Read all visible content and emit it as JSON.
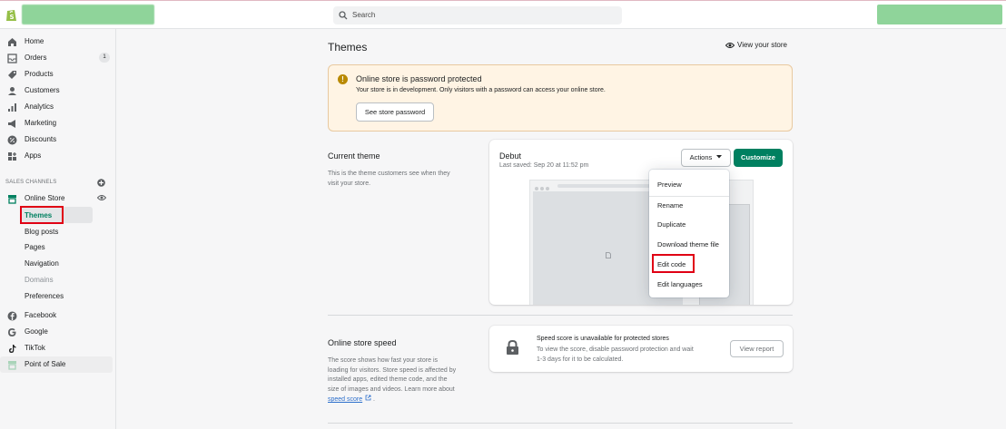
{
  "topbar": {
    "search_placeholder": "Search"
  },
  "sidebar": {
    "items": [
      {
        "label": "Home",
        "icon": "home-icon"
      },
      {
        "label": "Orders",
        "icon": "orders-icon",
        "badge": "1"
      },
      {
        "label": "Products",
        "icon": "tag-icon"
      },
      {
        "label": "Customers",
        "icon": "person-icon"
      },
      {
        "label": "Analytics",
        "icon": "bar-chart-icon"
      },
      {
        "label": "Marketing",
        "icon": "megaphone-icon"
      },
      {
        "label": "Discounts",
        "icon": "discount-icon"
      },
      {
        "label": "Apps",
        "icon": "apps-icon"
      }
    ],
    "sales_channels_label": "SALES CHANNELS",
    "online_store": {
      "label": "Online Store",
      "sub_items": [
        "Themes",
        "Blog posts",
        "Pages",
        "Navigation",
        "Domains",
        "Preferences"
      ]
    },
    "channels": [
      {
        "label": "Facebook",
        "icon": "facebook-icon"
      },
      {
        "label": "Google",
        "icon": "google-icon"
      },
      {
        "label": "TikTok",
        "icon": "tiktok-icon"
      },
      {
        "label": "Point of Sale",
        "icon": "pos-icon"
      }
    ]
  },
  "main": {
    "title": "Themes",
    "view_store": "View your store",
    "banner": {
      "title": "Online store is password protected",
      "body": "Your store is in development. Only visitors with a password can access your online store.",
      "button": "See store password"
    },
    "current_theme": {
      "title": "Current theme",
      "desc_line1": "This is the theme customers see when they",
      "desc_line2": "visit your store.",
      "name": "Debut",
      "saved": "Last saved: Sep 20 at 11:52 pm",
      "actions_label": "Actions",
      "customize_label": "Customize",
      "menu": [
        "Preview",
        "Rename",
        "Duplicate",
        "Download theme file",
        "Edit code",
        "Edit languages"
      ]
    },
    "speed": {
      "title": "Online store speed",
      "desc": [
        "The score shows how fast your store is",
        "loading for visitors. Store speed is affected by",
        "installed apps, edited theme code, and the",
        "size of images and videos. Learn more about"
      ],
      "link": "speed score",
      "card_title": "Speed score is unavailable for protected stores",
      "card_desc_line1": "To view the score, disable password protection and wait",
      "card_desc_line2": "1-3 days for it to be calculated.",
      "button": "View report"
    }
  },
  "colors": {
    "accent": "#008060",
    "highlight": "#e00014",
    "banner_bg": "#fff4e4"
  }
}
